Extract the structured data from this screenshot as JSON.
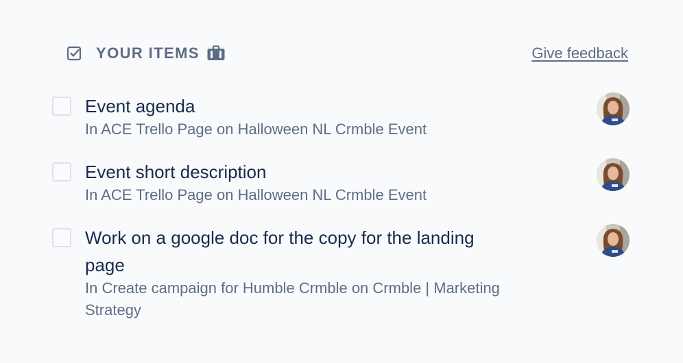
{
  "header": {
    "title": "YOUR ITEMS",
    "title_icon": "checkbox-icon",
    "badge_icon": "briefcase-icon",
    "feedback_label": "Give feedback"
  },
  "items": [
    {
      "title": "Event agenda",
      "subtitle": "In ACE Trello Page on Halloween NL Crmble Event",
      "checked": false,
      "avatar": "user-avatar"
    },
    {
      "title": "Event short description",
      "subtitle": "In ACE Trello Page on Halloween NL Crmble Event",
      "checked": false,
      "avatar": "user-avatar"
    },
    {
      "title": "Work on a google doc for the copy for the landing page",
      "subtitle": "In Create campaign for Humble Crmble on Crmble | Marketing Strategy",
      "checked": false,
      "avatar": "user-avatar"
    }
  ],
  "colors": {
    "background": "#f9fafc",
    "text_primary": "#172b4d",
    "text_secondary": "#5e6c84",
    "checkbox_border": "#dfe1e6"
  }
}
